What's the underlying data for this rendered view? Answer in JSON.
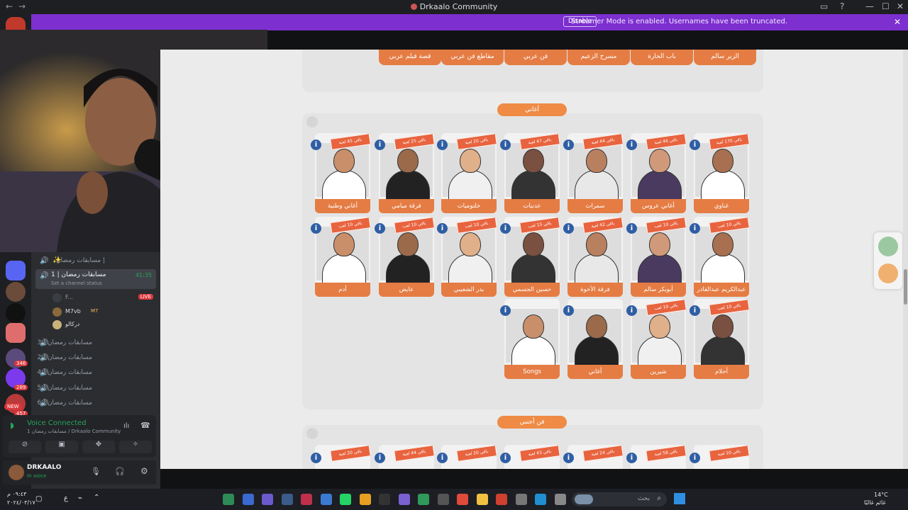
{
  "window": {
    "title": "Drkaalo Community",
    "back_icon": "←",
    "fwd_icon": "→"
  },
  "banner": {
    "message": "Streamer Mode is enabled. Usernames have been truncated.",
    "disable_label": "Disable"
  },
  "rail": {
    "badges": [
      "346",
      "289",
      "NEW",
      "457"
    ]
  },
  "channels": [
    {
      "name": "مسابقات رمضان |",
      "icon": "🔊",
      "extra": "✨"
    },
    {
      "name": "مسابقات رمضان | 1",
      "time": "41:35",
      "status": "Set a channel status"
    },
    {
      "name": "مسابقات رمضان | 3"
    },
    {
      "name": "مسابقات رمضان | 2"
    },
    {
      "name": "مسابقات رمضان | 4"
    },
    {
      "name": "مسابقات رمضان | 5"
    },
    {
      "name": "مسابقات رمضان | 6"
    }
  ],
  "voice_members": [
    {
      "name": "F...",
      "live": "LIVE"
    },
    {
      "name": "M7vb",
      "tag": "M7"
    },
    {
      "name": "دركالو"
    }
  ],
  "voice": {
    "status": "Voice Connected",
    "location": "1 مسابقات رمضان / Drkaalo Community"
  },
  "user": {
    "name": "DRKAALO",
    "status": "In voice"
  },
  "page": {
    "top_buttons": [
      "قصة فيلم عربي",
      "مقاطع فن عربي",
      "فن عربي",
      "مسرح الزعيم",
      "باب الحارة",
      "الزير سالم"
    ],
    "section1_title": "أغاني",
    "row1": [
      {
        "label": "أغاني وطنية",
        "tag": "باقي 45 لعبة"
      },
      {
        "label": "فرقة ميامي",
        "tag": "باقي 25 لعبة"
      },
      {
        "label": "خلتوميات",
        "tag": "باقي 20 لعبة"
      },
      {
        "label": "عدنيات",
        "tag": "باقي 47 لعبة"
      },
      {
        "label": "سمرات",
        "tag": "باقي 44 لعبة"
      },
      {
        "label": "أغاني عروس",
        "tag": "باقي 46 لعبة"
      },
      {
        "label": "غناوي",
        "tag": "باقي 170 لعبة"
      }
    ],
    "row2": [
      {
        "label": "أدم",
        "tag": "باقي 10 لعب"
      },
      {
        "label": "عايض",
        "tag": "باقي 10 لعب"
      },
      {
        "label": "بدر الشعيبي",
        "tag": "باقي 10 لعب"
      },
      {
        "label": "حسين الجسمي",
        "tag": "باقي 15 لعب"
      },
      {
        "label": "فرقة الأخوة",
        "tag": "باقي 42 لعبة"
      },
      {
        "label": "أبوبكر سالم",
        "tag": "باقي 10 لعب"
      },
      {
        "label": "عبدالكريم عبدالقادر",
        "tag": "باقي 10 لعب"
      }
    ],
    "row3": [
      {
        "label": "Songs",
        "tag": ""
      },
      {
        "label": "أغاني",
        "tag": ""
      },
      {
        "label": "شيرين",
        "tag": "باقي 10 لعب"
      },
      {
        "label": "أحلام",
        "tag": "باقي 10 لعب"
      }
    ],
    "section2_title": "فن أجنبي",
    "row4_tags": [
      "باقي 20 لعبة",
      "باقي 44 لعبة",
      "باقي 20 لعبة",
      "باقي 43 لعبة",
      "باقي 24 لعبة",
      "باقي 58 لعبة",
      "باقي 10 لعبة"
    ]
  },
  "taskbar": {
    "time": "٠٩:٤٣ م",
    "date": "٢٠٢٤/٠٣/١٧",
    "lang": "ع",
    "search_placeholder": "بحث",
    "weather_temp": "14°C",
    "weather_desc": "غائم غالبًا"
  },
  "colors": {
    "accent_orange": "#e57c43",
    "banner_purple": "#7d2fd0",
    "info_blue": "#2f5ea4",
    "voice_green": "#23a55a"
  }
}
